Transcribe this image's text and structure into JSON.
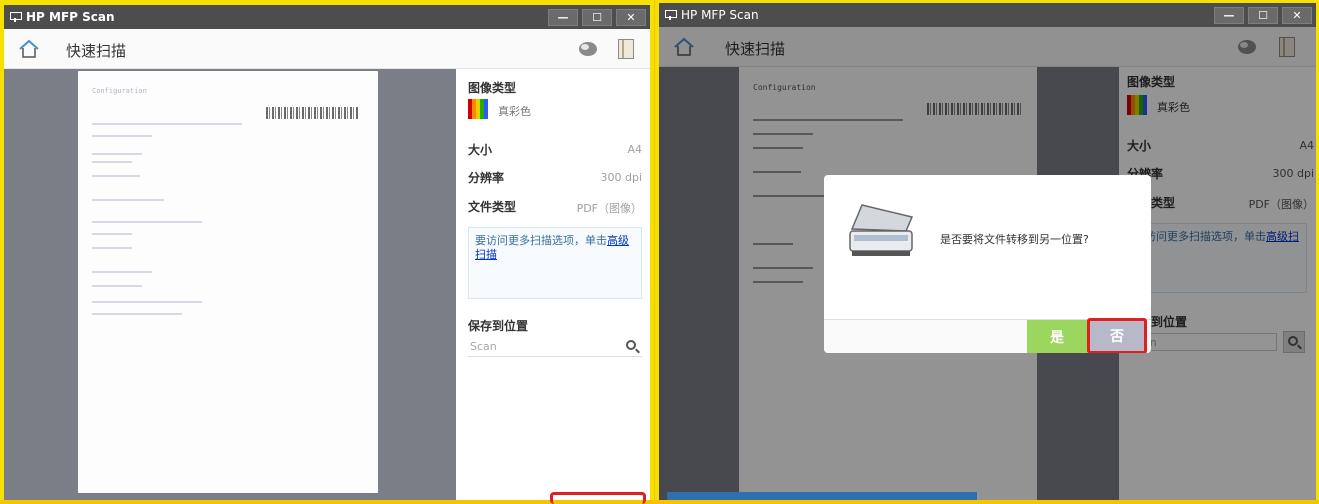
{
  "app": {
    "title": "HP MFP Scan",
    "min": "—",
    "max": "☐",
    "close": "✕"
  },
  "header": {
    "title": "快速扫描"
  },
  "preview": {
    "doc_title": "Configuration"
  },
  "settings": {
    "image_type_label": "图像类型",
    "image_type_value": "真彩色",
    "size_label": "大小",
    "size_value": "A4",
    "resolution_label": "分辨率",
    "resolution_value": "300 dpi",
    "filetype_label": "文件类型",
    "filetype_value": "PDF（图像）",
    "info_text": "要访问更多扫描选项，单击",
    "info_link": "高级扫描",
    "save_label": "保存到位置",
    "save_value": "Scan"
  },
  "dialog": {
    "message": "是否要将文件转移到另一位置?",
    "yes": "是",
    "no": "否"
  },
  "colors": {
    "accent_green": "#9bd65e",
    "highlight_red": "#e02020",
    "preview_bg": "#7c7e87"
  }
}
